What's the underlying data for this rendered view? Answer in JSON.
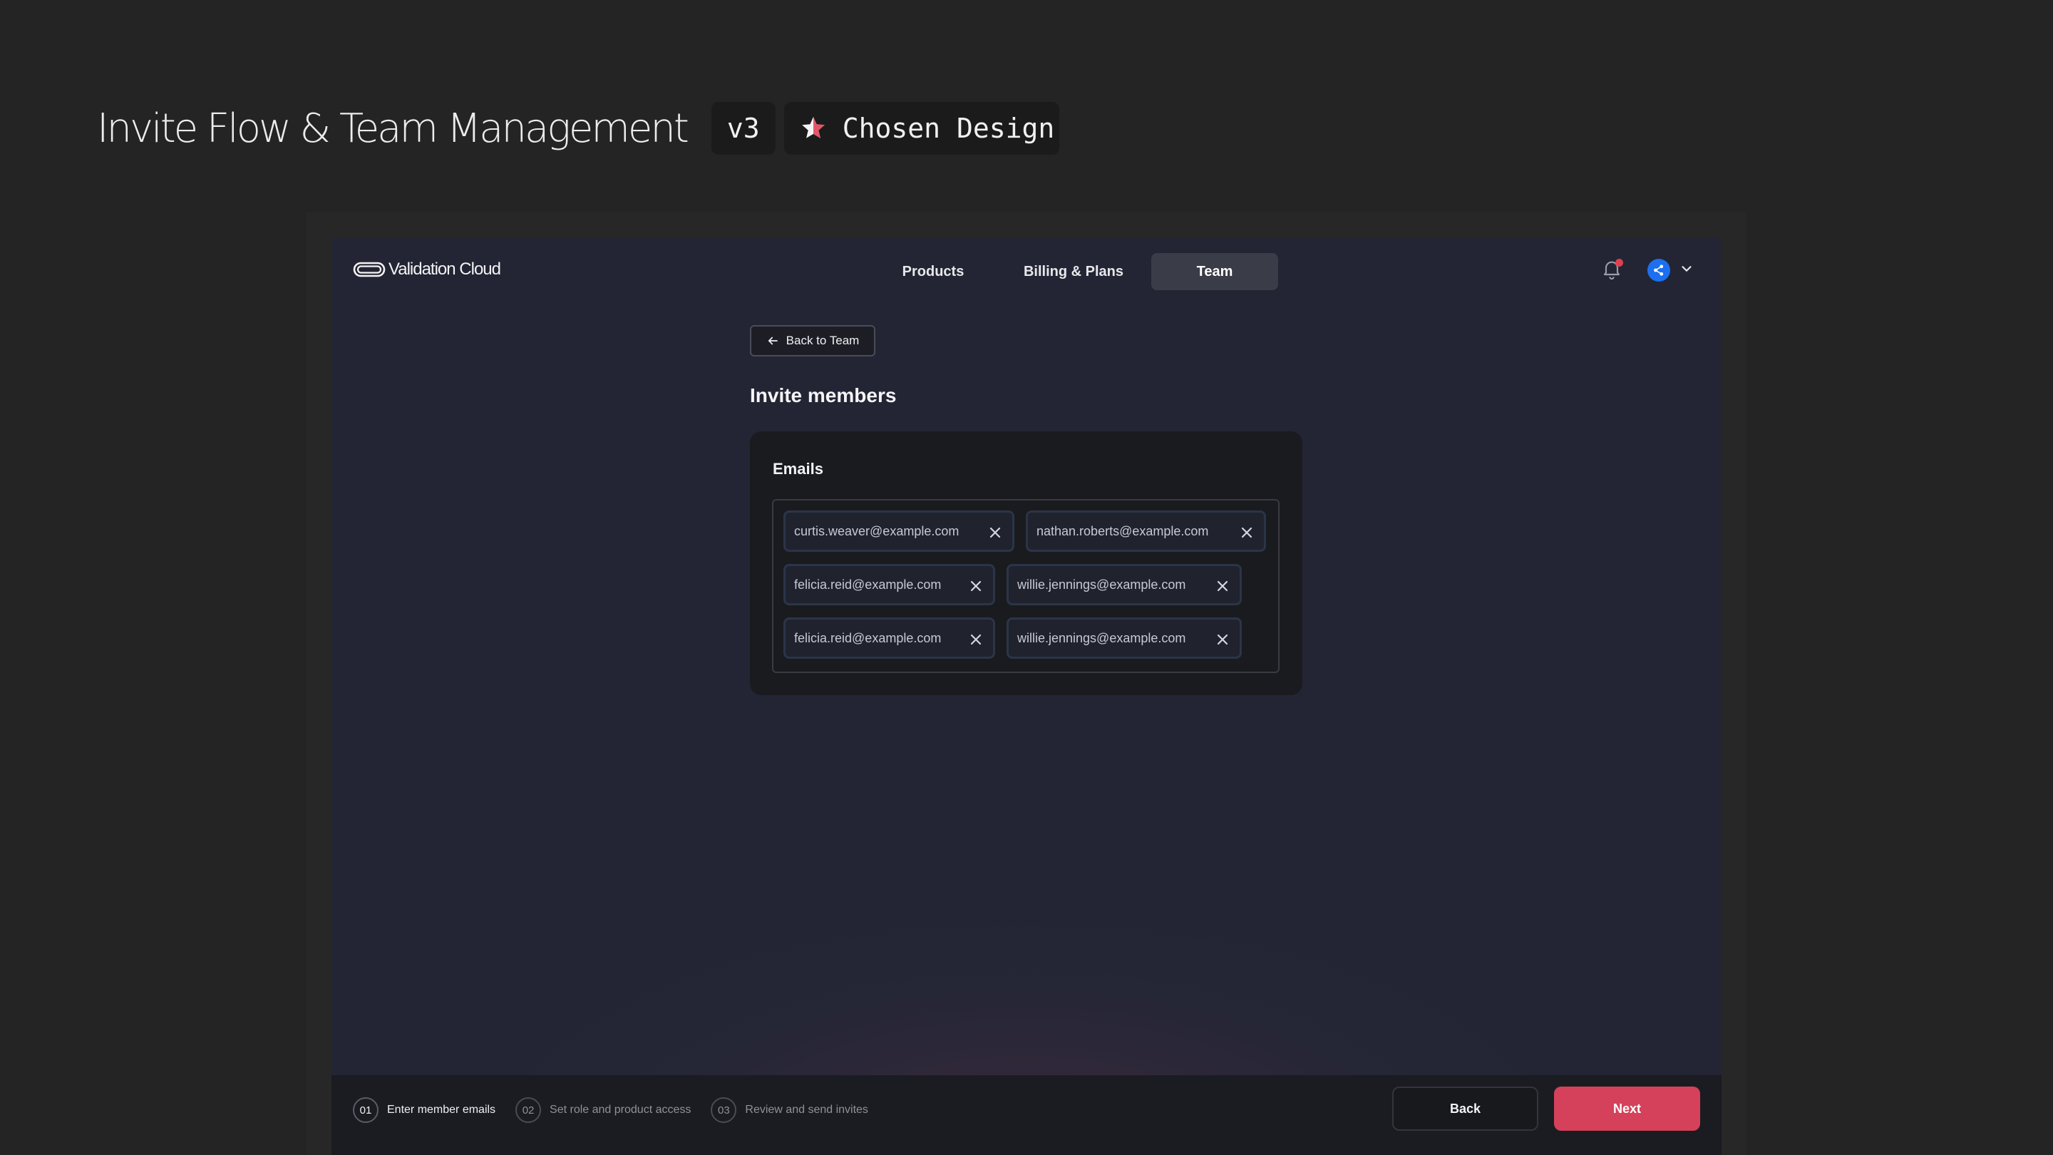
{
  "page": {
    "title": "Invite Flow & Team Management",
    "version_tag": "v3",
    "chosen_tag": "Chosen Design"
  },
  "app": {
    "logo_text": "Validation Cloud",
    "nav": [
      {
        "label": "Products"
      },
      {
        "label": "Billing & Plans"
      },
      {
        "label": "Team"
      }
    ],
    "active_nav": "Team"
  },
  "invite": {
    "back_label": "Back to Team",
    "title": "Invite members",
    "emails_label": "Emails",
    "emails": [
      "curtis.weaver@example.com",
      "nathan.roberts@example.com",
      "felicia.reid@example.com",
      "willie.jennings@example.com",
      "felicia.reid@example.com",
      "willie.jennings@example.com"
    ]
  },
  "footer": {
    "steps": [
      {
        "num": "01",
        "label": "Enter member emails"
      },
      {
        "num": "02",
        "label": "Set role and product access"
      },
      {
        "num": "03",
        "label": "Review and send invites"
      }
    ],
    "back_label": "Back",
    "next_label": "Next"
  },
  "colors": {
    "accent": "#d5415a",
    "avatar": "#1c6fee",
    "notification_dot": "#e0404e"
  }
}
